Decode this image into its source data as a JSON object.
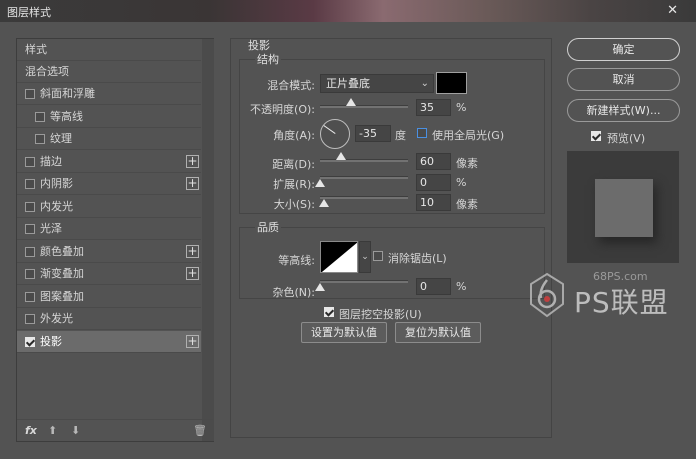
{
  "window": {
    "title": "图层样式",
    "close_glyph": "✕"
  },
  "styles_list": {
    "header": "样式",
    "blend_options": "混合选项",
    "items": [
      {
        "label": "斜面和浮雕",
        "checked": false,
        "plus": false,
        "indent": false
      },
      {
        "label": "等高线",
        "checked": false,
        "plus": false,
        "indent": true
      },
      {
        "label": "纹理",
        "checked": false,
        "plus": false,
        "indent": true
      },
      {
        "label": "描边",
        "checked": false,
        "plus": true,
        "indent": false
      },
      {
        "label": "内阴影",
        "checked": false,
        "plus": true,
        "indent": false
      },
      {
        "label": "内发光",
        "checked": false,
        "plus": false,
        "indent": false
      },
      {
        "label": "光泽",
        "checked": false,
        "plus": false,
        "indent": false
      },
      {
        "label": "颜色叠加",
        "checked": false,
        "plus": true,
        "indent": false
      },
      {
        "label": "渐变叠加",
        "checked": false,
        "plus": true,
        "indent": false
      },
      {
        "label": "图案叠加",
        "checked": false,
        "plus": false,
        "indent": false
      },
      {
        "label": "外发光",
        "checked": false,
        "plus": false,
        "indent": false
      },
      {
        "label": "投影",
        "checked": true,
        "plus": true,
        "indent": false,
        "active": true
      }
    ],
    "plus_glyph": "+",
    "footer": {
      "fx": "fx",
      "up": "⬆",
      "down": "⬇",
      "trash": "🗑"
    }
  },
  "drop_shadow": {
    "section_title": "投影",
    "structure": {
      "title": "结构",
      "blend_mode_label": "混合模式:",
      "blend_mode_value": "正片叠底",
      "shadow_color": "#000000",
      "opacity_label": "不透明度(O):",
      "opacity_value": "35",
      "opacity_percent": 35,
      "percent_unit": "%",
      "angle_label": "角度(A):",
      "angle_value": "-35",
      "angle_unit": "度",
      "global_light_label": "使用全局光(G)",
      "global_light_checked": false,
      "distance_label": "距离(D):",
      "distance_value": "60",
      "distance_fraction": 0.24,
      "size_unit": "像素",
      "spread_label": "扩展(R):",
      "spread_value": "0",
      "spread_percent": 0,
      "size_label": "大小(S):",
      "size_value": "10",
      "size_fraction": 0.04
    },
    "quality": {
      "title": "品质",
      "contour_label": "等高线:",
      "anti_alias_label": "消除锯齿(L)",
      "anti_alias_checked": false,
      "noise_label": "杂色(N):",
      "noise_value": "0",
      "noise_percent": 0
    },
    "knockout_label": "图层挖空投影(U)",
    "knockout_checked": true,
    "set_default": "设置为默认值",
    "reset_default": "复位为默认值"
  },
  "actions": {
    "ok": "确定",
    "cancel": "取消",
    "new_style": "新建样式(W)...",
    "preview_label": "预览(V)",
    "preview_checked": true
  },
  "watermark": {
    "url": "68PS.com",
    "brand": "PS联盟"
  },
  "chev_glyph": "⌄"
}
